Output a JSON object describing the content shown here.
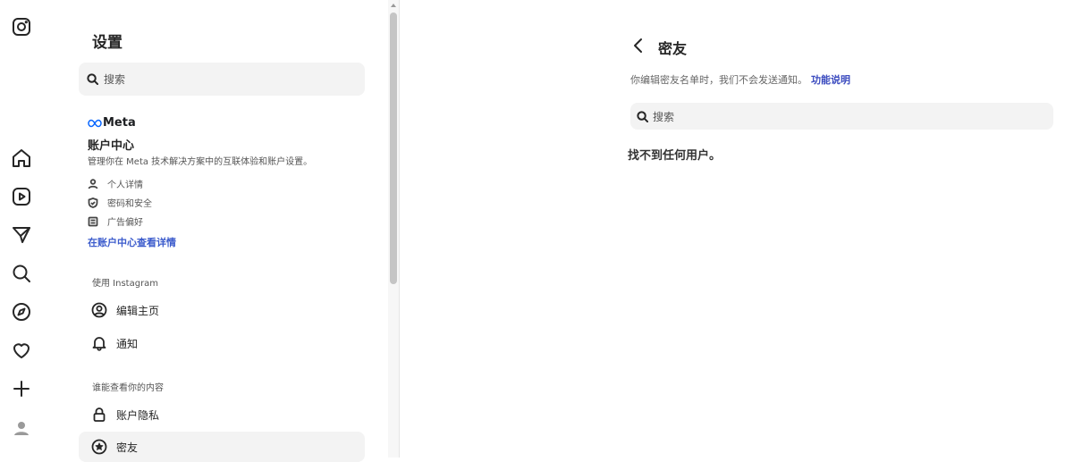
{
  "nav": {
    "items": [
      "instagram-logo",
      "home",
      "reels",
      "messages",
      "search",
      "explore",
      "notifications",
      "create",
      "profile"
    ]
  },
  "settings": {
    "title": "设置",
    "search_placeholder": "搜索",
    "accounts_center": {
      "brand": "Meta",
      "title": "账户中心",
      "description": "管理你在 Meta 技术解决方案中的互联体验和账户设置。",
      "items": [
        {
          "label": "个人详情",
          "icon": "person-icon"
        },
        {
          "label": "密码和安全",
          "icon": "shield-icon"
        },
        {
          "label": "广告偏好",
          "icon": "ad-icon"
        }
      ],
      "link": "在账户中心查看详情"
    },
    "section_using": "使用 Instagram",
    "using_items": [
      {
        "label": "编辑主页",
        "icon": "user-circle-icon"
      },
      {
        "label": "通知",
        "icon": "bell-icon"
      }
    ],
    "section_visibility": "谁能查看你的内容",
    "visibility_items": [
      {
        "label": "账户隐私",
        "icon": "lock-icon"
      },
      {
        "label": "密友",
        "icon": "star-circle-icon",
        "active": true
      }
    ]
  },
  "content": {
    "title": "密友",
    "info_text": "你编辑密友名单时，我们不会发送通知。",
    "info_link": "功能说明",
    "search_placeholder": "搜索",
    "empty_text": "找不到任何用户。"
  },
  "colors": {
    "link": "#3b5bcc",
    "search_bg": "#f3f3f3",
    "active_bg": "#f3f3f3"
  }
}
